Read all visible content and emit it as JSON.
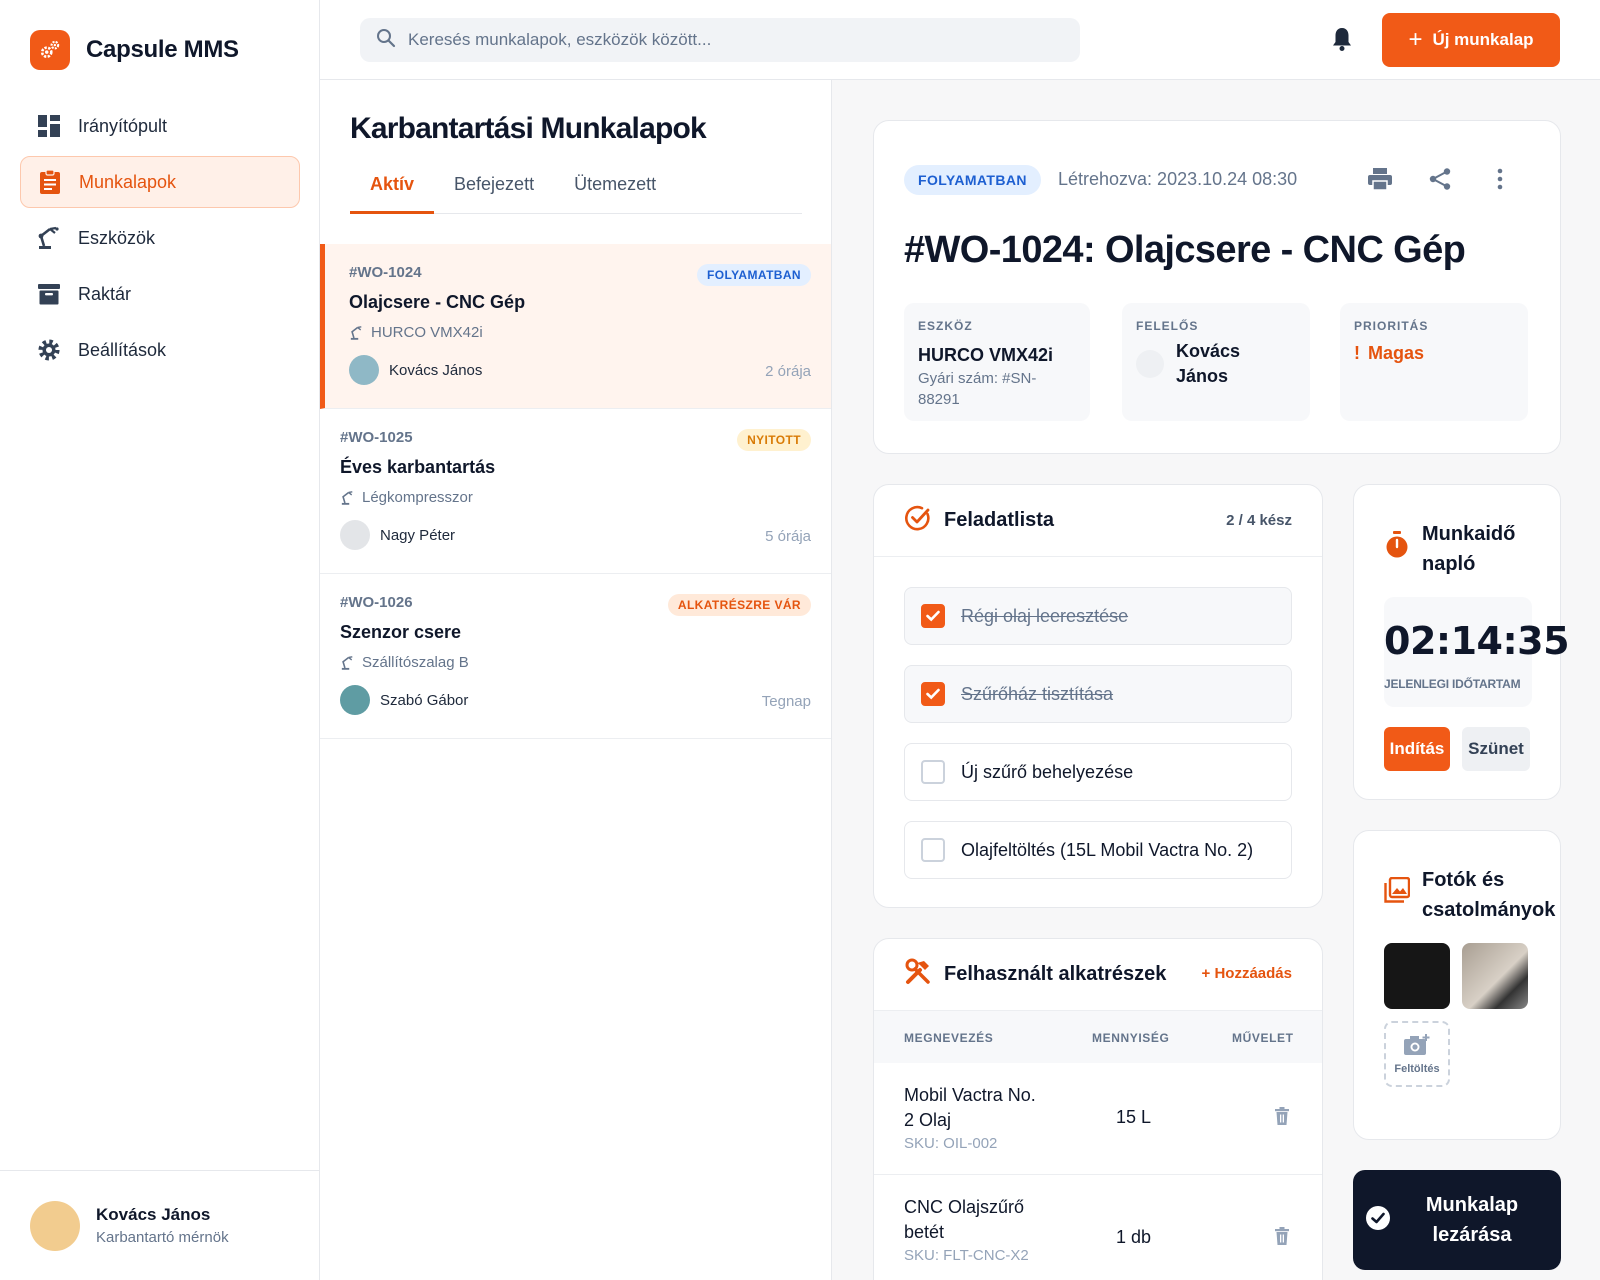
{
  "app": {
    "name": "Capsule MMS"
  },
  "sidebar": {
    "items": [
      {
        "label": "Irányítópult",
        "icon": "dashboard-icon"
      },
      {
        "label": "Munkalapok",
        "icon": "clipboard-icon"
      },
      {
        "label": "Eszközök",
        "icon": "robot-arm-icon"
      },
      {
        "label": "Raktár",
        "icon": "archive-icon"
      },
      {
        "label": "Beállítások",
        "icon": "gear-icon"
      }
    ],
    "active_index": 1,
    "user": {
      "name": "Kovács János",
      "role": "Karbantartó mérnök"
    }
  },
  "topbar": {
    "search_placeholder": "Keresés munkalapok, eszközök között...",
    "new_button": "Új munkalap",
    "accent": "#F15A17"
  },
  "list": {
    "title": "Karbantartási Munkalapok",
    "tabs": [
      "Aktív",
      "Befejezett",
      "Ütemezett"
    ],
    "active_tab": 0,
    "items": [
      {
        "id": "#WO-1024",
        "status": "FOLYAMATBAN",
        "title": "Olajcsere - CNC Gép",
        "asset": "HURCO VMX42i",
        "person": "Kovács János",
        "time": "2 órája"
      },
      {
        "id": "#WO-1025",
        "status": "NYITOTT",
        "title": "Éves karbantartás",
        "asset": "Légkompresszor",
        "person": "Nagy Péter",
        "time": "5 órája"
      },
      {
        "id": "#WO-1026",
        "status": "ALKATRÉSZRE VÁR",
        "title": "Szenzor csere",
        "asset": "Szállítószalag B",
        "person": "Szabó Gábor",
        "time": "Tegnap"
      }
    ]
  },
  "detail": {
    "status": "FOLYAMATBAN",
    "created": "Létrehozva: 2023.10.24 08:30",
    "title": "#WO-1024: Olajcsere - CNC Gép",
    "asset_label": "ESZKÖZ",
    "asset_value": "HURCO VMX42i",
    "asset_serial": "Gyári szám: #SN-88291",
    "owner_label": "FELELŐS",
    "owner_value": "Kovács János",
    "priority_label": "PRIORITÁS",
    "priority_value": "Magas"
  },
  "tasks": {
    "title": "Feladatlista",
    "progress": "2 / 4 kész",
    "items": [
      {
        "label": "Régi olaj leeresztése",
        "done": true
      },
      {
        "label": "Szűrőház tisztítása",
        "done": true
      },
      {
        "label": "Új szűrő behelyezése",
        "done": false
      },
      {
        "label": "Olajfeltöltés (15L Mobil Vactra No. 2)",
        "done": false
      }
    ]
  },
  "parts": {
    "title": "Felhasznált alkatrészek",
    "add": "+ Hozzáadás",
    "headers": [
      "MEGNEVEZÉS",
      "MENNYISÉG",
      "MŰVELET"
    ],
    "rows": [
      {
        "name": "Mobil Vactra No. 2 Olaj",
        "sku": "SKU: OIL-002",
        "qty": "15 L"
      },
      {
        "name": "CNC Olajszűrő betét",
        "sku": "SKU: FLT-CNC-X2",
        "qty": "1 db"
      }
    ]
  },
  "timer": {
    "title": "Munkaidő napló",
    "time": "02:14:35",
    "label": "JELENLEGI IDŐTARTAM",
    "start": "Indítás",
    "pause": "Szünet"
  },
  "photos": {
    "title": "Fotók és csatolmányok",
    "upload": "Feltöltés"
  },
  "close_button": "Munkalap lezárása"
}
